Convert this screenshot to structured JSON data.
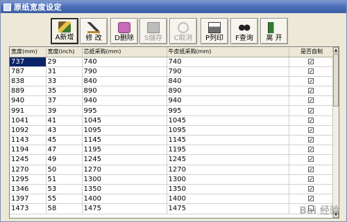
{
  "window": {
    "title": "原纸宽度设定"
  },
  "toolbar": {
    "buttons": [
      {
        "label": "A新增",
        "icon": "add-icon"
      },
      {
        "label": "修 改",
        "icon": "edit-icon"
      },
      {
        "label": "D删除",
        "icon": "delete-icon"
      },
      {
        "label": "S儲存",
        "icon": "save-icon"
      },
      {
        "label": "C取消",
        "icon": "cancel-icon"
      },
      {
        "label": "P列印",
        "icon": "print-icon"
      },
      {
        "label": "F查询",
        "icon": "binoculars-icon"
      },
      {
        "label": "离 开",
        "icon": "exit-icon"
      }
    ]
  },
  "grid": {
    "columns": [
      "宽度(mm)",
      "宽度(inch)",
      "芯纸采购(mm)",
      "牛皮纸采购(mm)",
      "是否自制"
    ],
    "rows": [
      [
        "737",
        "29",
        "740",
        "740",
        "✓"
      ],
      [
        "787",
        "31",
        "790",
        "790",
        "✓"
      ],
      [
        "838",
        "33",
        "840",
        "840",
        "✓"
      ],
      [
        "889",
        "35",
        "890",
        "890",
        "✓"
      ],
      [
        "940",
        "37",
        "940",
        "940",
        "✓"
      ],
      [
        "991",
        "39",
        "995",
        "995",
        "✓"
      ],
      [
        "1041",
        "41",
        "1045",
        "1045",
        "✓"
      ],
      [
        "1092",
        "43",
        "1095",
        "1095",
        "✓"
      ],
      [
        "1143",
        "45",
        "1145",
        "1145",
        "✓"
      ],
      [
        "1194",
        "47",
        "1195",
        "1195",
        "✓"
      ],
      [
        "1245",
        "49",
        "1245",
        "1245",
        "✓"
      ],
      [
        "1270",
        "50",
        "1270",
        "1270",
        "✓"
      ],
      [
        "1295",
        "51",
        "1300",
        "1300",
        "✓"
      ],
      [
        "1346",
        "53",
        "1350",
        "1350",
        "✓"
      ],
      [
        "1397",
        "55",
        "1400",
        "1400",
        "✓"
      ],
      [
        "1473",
        "58",
        "1475",
        "1475",
        ""
      ]
    ]
  },
  "watermark": "Bai 经验"
}
